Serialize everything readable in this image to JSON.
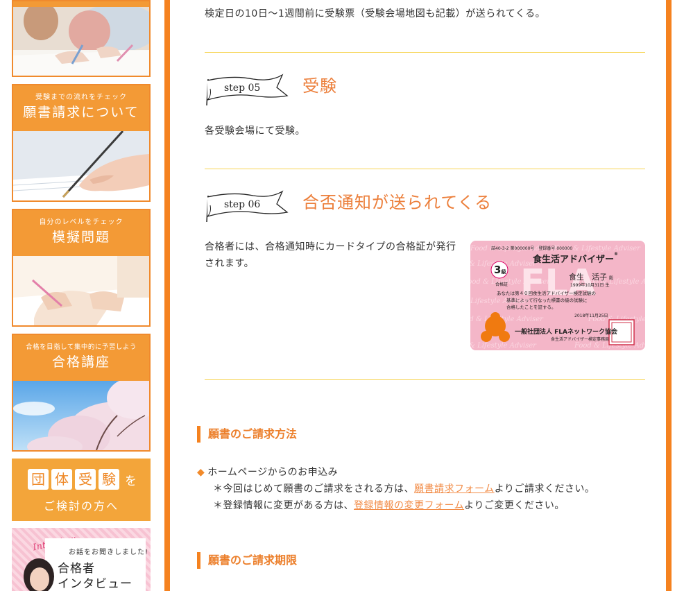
{
  "sidebar": {
    "banners": [
      {
        "name": "application",
        "sub": "受験までの流れをチェック",
        "title": "願書請求について"
      },
      {
        "name": "mock-exam",
        "sub": "自分のレベルをチェック",
        "title": "模擬問題"
      },
      {
        "name": "course",
        "sub": "合格を目指して集中的に予習しよう",
        "title": "合格講座"
      }
    ],
    "group": {
      "chars": [
        "団",
        "体",
        "受",
        "験"
      ],
      "suffix": "を",
      "line2": "ご検討の方へ"
    },
    "interview": {
      "script": "Interview",
      "small": "お話をお聞きしました!",
      "line1": "合格者",
      "line2": "インタビュー"
    }
  },
  "main": {
    "intro_text": "検定日の10日〜1週間前に受験票（受験会場地図も記載）が送られてくる。",
    "steps": [
      {
        "label": "step 05",
        "title": "受験",
        "text": "各受験会場にて受験。"
      },
      {
        "label": "step 06",
        "title": "合否通知が送られてくる",
        "text": "合格者には、合格通知時にカードタイプの合格証が発行されます。"
      }
    ],
    "certificate": {
      "reg_no": "詰40-3-2 第000000号　登録番号 000000",
      "title": "食生活アドバイザー",
      "reg_mark": "®",
      "grade": "3",
      "grade_suffix": "級",
      "grade_label": "合格証",
      "name": "食生　活子",
      "name_suffix": "殿",
      "birth": "1999年10月31日 生",
      "body1": "あなたは第４０回食生活アドバイザー検定試験の",
      "body2": "基準によって行なった標書の級の試験に",
      "body3": "合格したことを証する。",
      "date": "2018年11月25日",
      "org": "一般社団法人 FLAネットワーク協会",
      "org_sub": "食生活アドバイザー検定事務局",
      "watermark": "FLA",
      "pattern_text": "Food & Lifestyle Adviser"
    },
    "sections": [
      {
        "title": "願書のご請求方法"
      },
      {
        "title": "願書のご請求期限"
      }
    ],
    "request": {
      "bullet": "◆",
      "heading": "ホームページからのお申込み",
      "line1_pre": "＊今回はじめて願書のご請求をされる方は、",
      "line1_link": "願書請求フォーム",
      "line1_post": "よりご請求ください。",
      "line2_pre": "＊登録情報に変更がある方は、",
      "line2_link": "登録情報の変更フォーム",
      "line2_post": "よりご変更ください。"
    }
  },
  "colors": {
    "accent": "#f5821f",
    "divider": "#f7d451",
    "title": "#ec7f3b",
    "card": "#f4b8c9"
  }
}
